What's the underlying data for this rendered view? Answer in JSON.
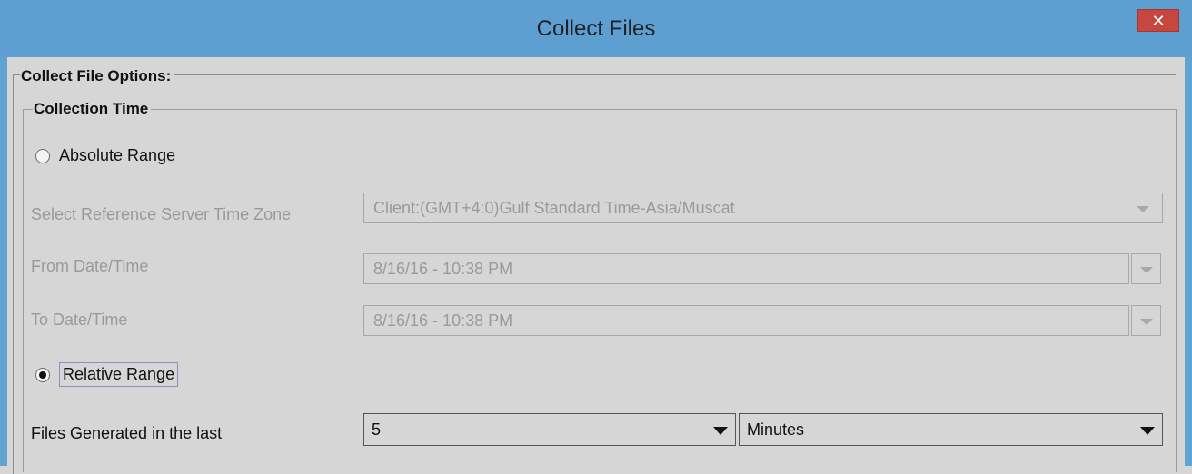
{
  "window": {
    "title": "Collect Files",
    "close_glyph": "✕"
  },
  "options_group": {
    "title": "Collect File Options:"
  },
  "collection_time": {
    "title": "Collection Time",
    "absolute": {
      "label": "Absolute Range",
      "selected": false,
      "time_zone_label": "Select Reference Server Time Zone",
      "time_zone_value": "Client:(GMT+4:0)Gulf Standard Time-Asia/Muscat",
      "from_label": "From Date/Time",
      "from_value": "8/16/16 - 10:38 PM",
      "to_label": "To Date/Time",
      "to_value": "8/16/16 - 10:38 PM"
    },
    "relative": {
      "label": "Relative Range",
      "selected": true,
      "files_label": "Files Generated in the last",
      "amount_value": "5",
      "unit_value": "Minutes"
    }
  },
  "colors": {
    "titlebar": "#5d9fd0",
    "close_button": "#c7463e",
    "panel": "#d6d6d6",
    "disabled_text": "#9a9a9a"
  }
}
